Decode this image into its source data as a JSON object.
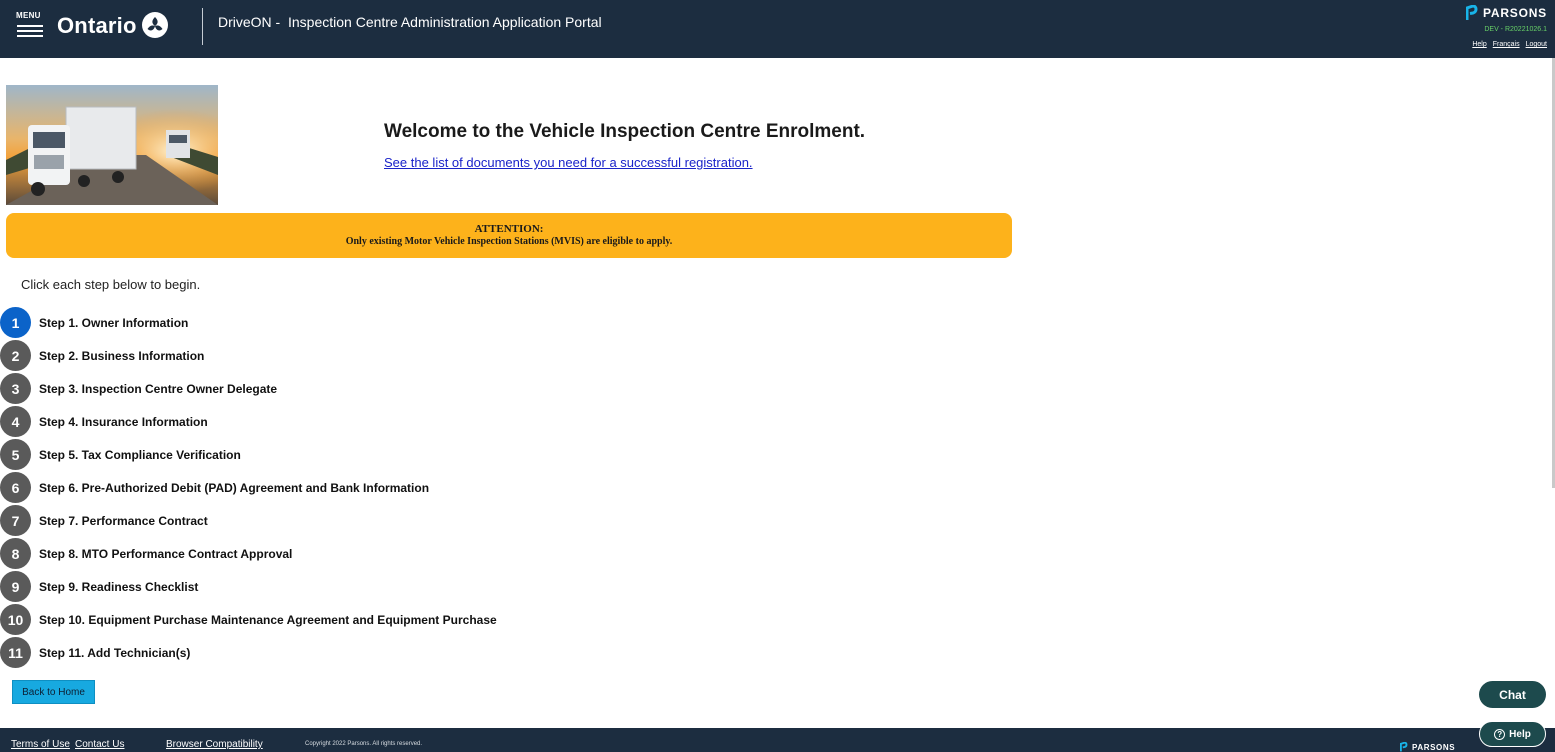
{
  "header": {
    "menu_label": "MENU",
    "ontario_word": "Ontario",
    "app_title": "DriveON -  Inspection Centre Administration Application Portal",
    "brand_name": "PARSONS",
    "env_tag": "DEV - R20221026.1",
    "links": {
      "help": "Help",
      "francais": "Français",
      "logout": "Logout"
    }
  },
  "hero": {
    "welcome": "Welcome to the Vehicle Inspection Centre Enrolment.",
    "docs_link": "See the list of documents you need for a successful registration."
  },
  "attention": {
    "title": "ATTENTION:",
    "text": "Only existing Motor Vehicle Inspection Stations (MVIS) are eligible to apply."
  },
  "intro": "Click each step below to begin.",
  "steps": [
    {
      "num": "1",
      "label": "Step 1. Owner Information"
    },
    {
      "num": "2",
      "label": "Step 2. Business Information"
    },
    {
      "num": "3",
      "label": "Step 3. Inspection Centre Owner Delegate"
    },
    {
      "num": "4",
      "label": "Step 4. Insurance Information"
    },
    {
      "num": "5",
      "label": "Step 5. Tax Compliance Verification"
    },
    {
      "num": "6",
      "label": "Step 6. Pre-Authorized Debit (PAD) Agreement and Bank Information"
    },
    {
      "num": "7",
      "label": "Step 7. Performance Contract"
    },
    {
      "num": "8",
      "label": "Step 8. MTO Performance Contract Approval"
    },
    {
      "num": "9",
      "label": "Step 9. Readiness Checklist"
    },
    {
      "num": "10",
      "label": "Step 10. Equipment Purchase Maintenance Agreement and Equipment Purchase"
    },
    {
      "num": "11",
      "label": "Step 11. Add Technician(s)"
    }
  ],
  "back_button": "Back to Home",
  "chat_button": "Chat",
  "help_button": "Help",
  "footer": {
    "terms": "Terms of Use",
    "contact": "Contact Us",
    "browser": "Browser Compatibility",
    "copyright": "Copyright 2022 Parsons. All rights reserved.",
    "logo_text": "PARSONS"
  },
  "colors": {
    "header_bg": "#1c2d40",
    "attention_bg": "#fdb21b",
    "active_step": "#0b63c9",
    "inactive_step": "#5a5a5a",
    "back_button": "#17a9e0",
    "chat_bg": "#1d4a4d"
  }
}
